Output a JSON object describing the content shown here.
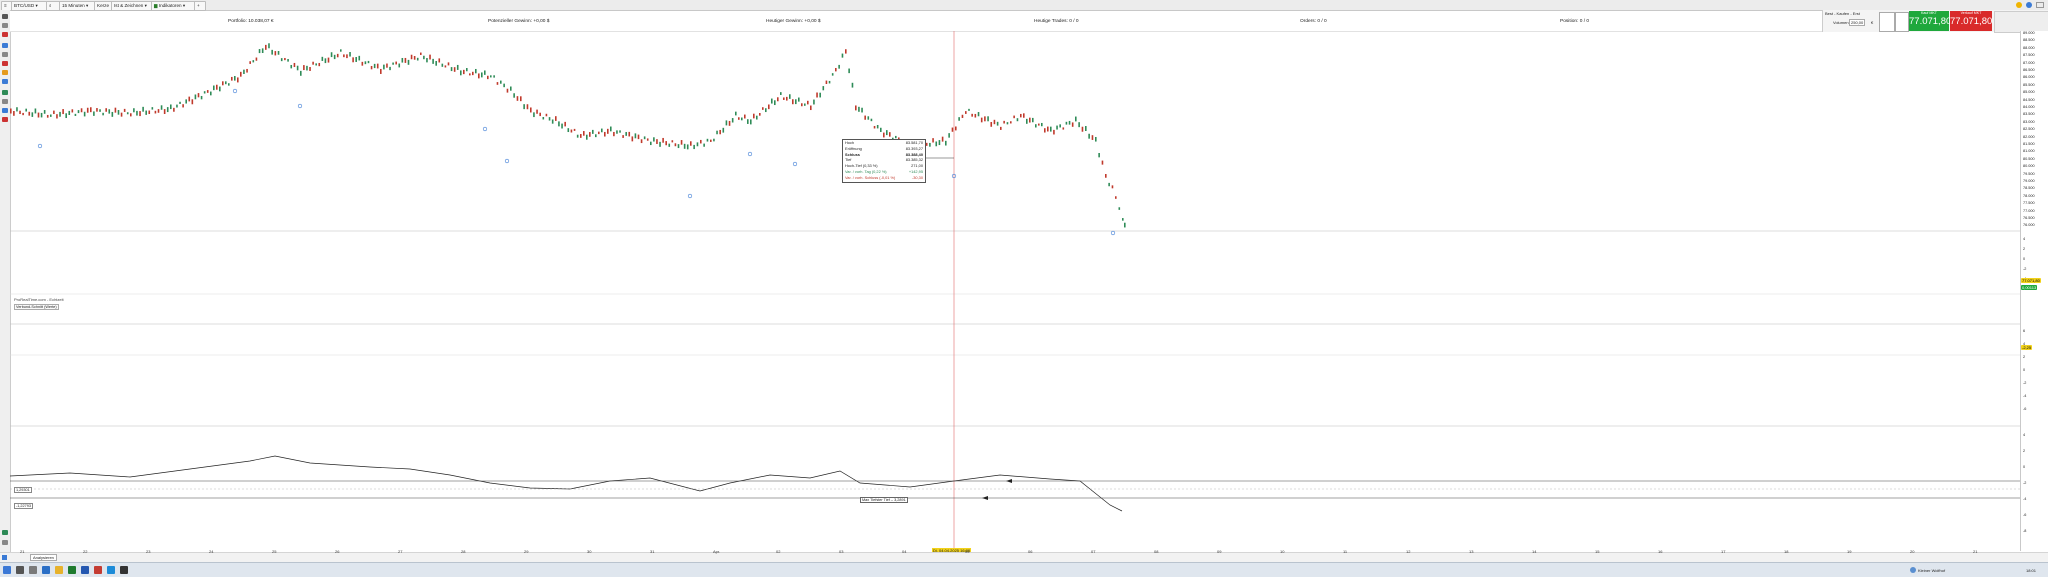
{
  "toolbar": {
    "symbol": "BTC/USD",
    "interval": "15 Minuten",
    "chart_style": "Kerze",
    "mode": "Ist & Zeichnen",
    "indicators": "Indikatoren"
  },
  "info": {
    "portfolio": "Portfolio: 10.038,07 €",
    "potential_gain": "Potenzieller Gewinn: +0,00 $",
    "today_gain": "Heutiger Gewinn: +0,00 $",
    "today_trades": "Heutige Trades: 0 / 0",
    "orders": "Orders: 0 / 0",
    "positions": "Position: 0 / 0"
  },
  "trade_panel": {
    "order_type": "Best - Kaufen - Erst",
    "volume_label": "Volumen",
    "volume_value": "250,00",
    "qty_unit": "€",
    "kauf_label": "Kauf MKT",
    "kauf_price": "77.071,80",
    "verkauf_label": "Verkauf MKT",
    "verkauf_price": "77.071,80"
  },
  "chart": {
    "watermark": "ProRealTime.com - Echtzeit",
    "indicator_tag": "Verbund-Schnitt (Werte)",
    "tooltip": {
      "hoch_l": "Hoch",
      "hoch_v": "83.581,70",
      "eroeff_l": "Eröffnung",
      "eroeff_v": "83.393,27",
      "schluss_l": "Schluss",
      "schluss_v": "83.388,40",
      "tief_l": "Tief",
      "tief_v": "83.385,32",
      "hoch_tief_l": "Hoch-Tief (0,33 %)",
      "hoch_tief_v": "271,00",
      "var_vtag_l": "Var. / vorh. Tag (0,22 %)",
      "var_vtag_v": "+142,95",
      "var_vschl_l": "Var. / vorh. Schluss (-0,01 %)",
      "var_vschl_v": "-30,30"
    },
    "osc_label": "Max Tiefster Tief – 3,2891",
    "level_upper": "1,29301",
    "level_lower": "-1,22793",
    "cursor_date": "Di. 04.04.2025 16:00",
    "price_badge": "77.071,80",
    "volume_badge": "0,00113",
    "mid_badge": "-2,25"
  },
  "yaxis_main": [
    "89.000",
    "88.500",
    "88.000",
    "87.500",
    "87.000",
    "86.500",
    "86.000",
    "85.500",
    "85.000",
    "84.500",
    "84.000",
    "83.500",
    "83.000",
    "82.500",
    "82.000",
    "81.500",
    "81.000",
    "80.500",
    "80.000",
    "79.500",
    "79.000",
    "78.500",
    "78.000",
    "77.500",
    "77.000",
    "76.500",
    "76.000"
  ],
  "yaxis_p2": [
    "4",
    "2",
    "0",
    "-2",
    "-4",
    "-6"
  ],
  "yaxis_p3": [
    "6",
    "4",
    "2",
    "0",
    "-2",
    "-4",
    "-6"
  ],
  "yaxis_p4": [
    "4",
    "2",
    "0",
    "-2",
    "-4",
    "-6",
    "-8"
  ],
  "xaxis": [
    "21",
    "22",
    "23",
    "24",
    "25",
    "26",
    "27",
    "28",
    "29",
    "30",
    "31",
    "Apr.",
    "02",
    "03",
    "04",
    "05",
    "06",
    "07",
    "08",
    "09",
    "10",
    "11",
    "12",
    "13",
    "14",
    "15",
    "16",
    "17",
    "18",
    "19",
    "20",
    "21"
  ],
  "taskbar": {
    "weather": "Kleiner Wolfhof",
    "time": "18:01",
    "app_tab": "Analysieren"
  },
  "colors": {
    "buy": "#1fa83c",
    "sell": "#d92a2a",
    "up": "#2e8b57",
    "down": "#c0392b",
    "cursor": "#e36b6b"
  }
}
